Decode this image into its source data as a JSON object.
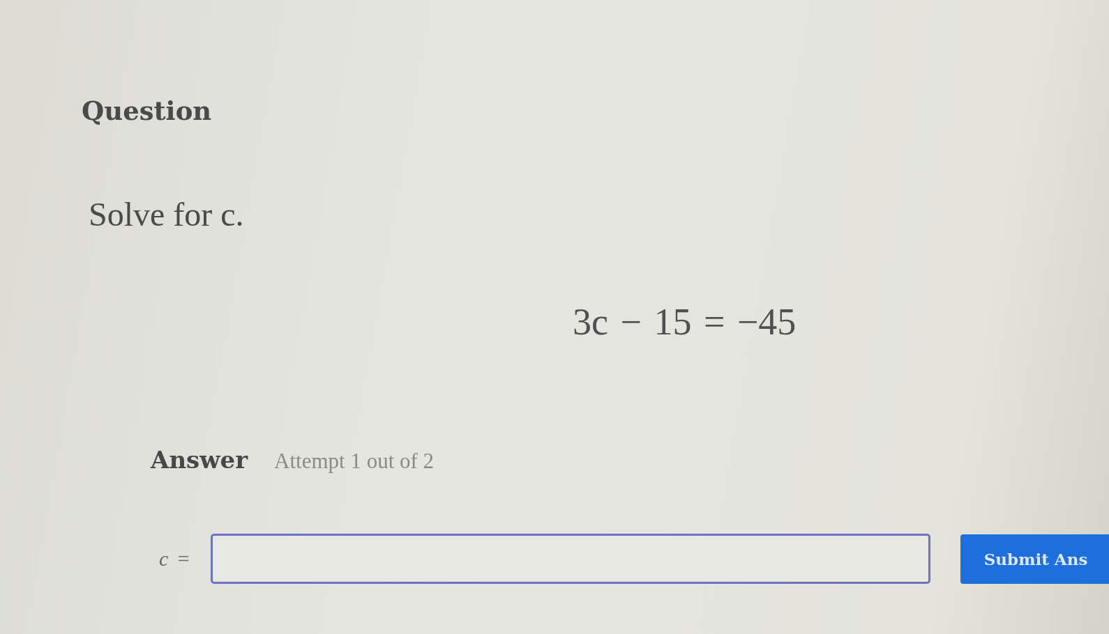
{
  "question": {
    "heading": "Question",
    "prompt": "Solve for c.",
    "equation": "3c − 15 = −45"
  },
  "answer": {
    "heading": "Answer",
    "attempt": "Attempt 1 out of 2",
    "field_label": "*c* =",
    "submit_button": "Submit Ans"
  }
}
